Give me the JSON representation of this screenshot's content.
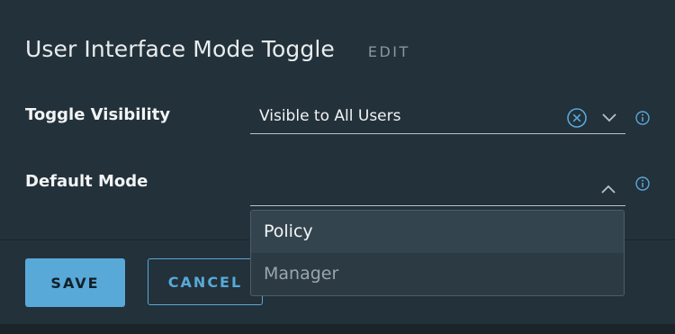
{
  "dialog": {
    "title": "User Interface Mode Toggle",
    "edit_label": "EDIT"
  },
  "fields": {
    "toggle_visibility": {
      "label": "Toggle Visibility",
      "value": "Visible to All Users",
      "clear_icon": "clear-circle-icon",
      "chevron_icon": "chevron-down-icon",
      "info_icon": "info-icon"
    },
    "default_mode": {
      "label": "Default Mode",
      "value": "",
      "chevron_icon": "chevron-up-icon",
      "info_icon": "info-icon",
      "options": [
        "Policy",
        "Manager"
      ],
      "highlighted_option": "Policy"
    }
  },
  "buttons": {
    "save_label": "SAVE",
    "cancel_label": "CANCEL"
  },
  "colors": {
    "accent": "#58a9d8",
    "background": "#23313a",
    "text": "#f2f4f5"
  }
}
